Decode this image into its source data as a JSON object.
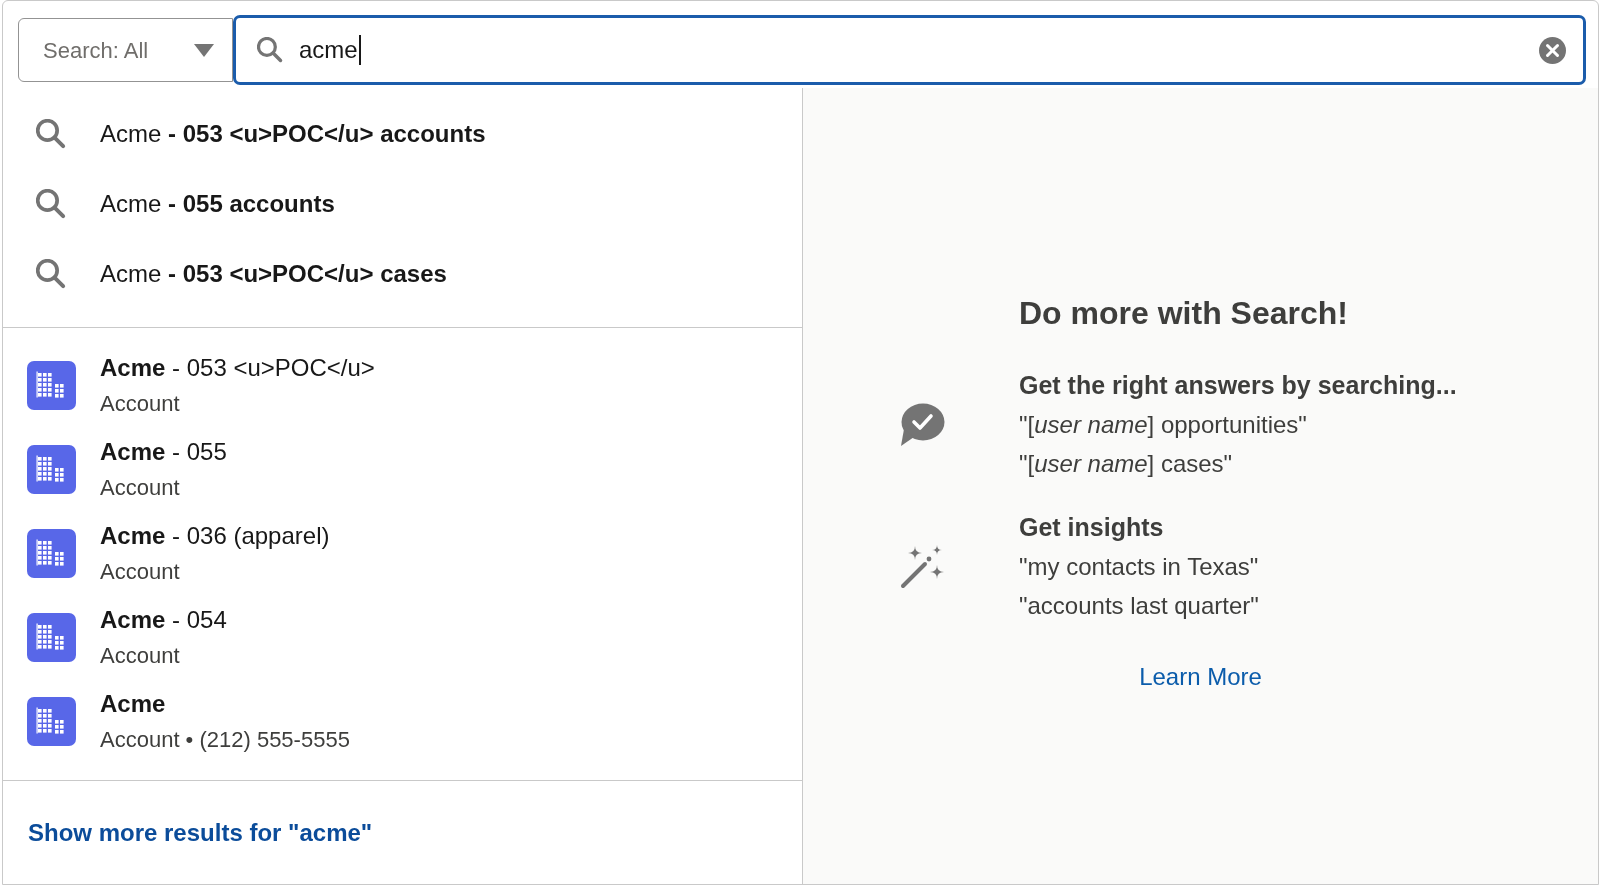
{
  "search": {
    "scope": "Search: All",
    "value": "acme"
  },
  "suggestions": [
    {
      "query": "Acme",
      "completion": "- 053 <u>POC</u> accounts"
    },
    {
      "query": "Acme",
      "completion": "- 055 accounts"
    },
    {
      "query": "Acme",
      "completion": "- 053 <u>POC</u> cases"
    }
  ],
  "results": [
    {
      "name": "Acme",
      "detail": "- 053 <u>POC</u>",
      "subtitle": "Account"
    },
    {
      "name": "Acme",
      "detail": "- 055",
      "subtitle": "Account"
    },
    {
      "name": "Acme",
      "detail": "- 036 (apparel)",
      "subtitle": "Account"
    },
    {
      "name": "Acme",
      "detail": "- 054",
      "subtitle": "Account"
    },
    {
      "name": "Acme",
      "subtitle": "Account • (212) 555-5555"
    }
  ],
  "show_more": "Show more results for \"acme\"",
  "tips": {
    "heading": "Do more with Search!",
    "sections": [
      {
        "kind": "answers",
        "title": "Get the right answers by searching...",
        "examples": [
          "\"[*user name*] opportunities\"",
          "\"[*user name*] cases\""
        ]
      },
      {
        "kind": "insights",
        "title": "Get insights",
        "examples": [
          "\"my contacts in Texas\"",
          "\"accounts last quarter\""
        ]
      }
    ],
    "link": "Learn More"
  }
}
